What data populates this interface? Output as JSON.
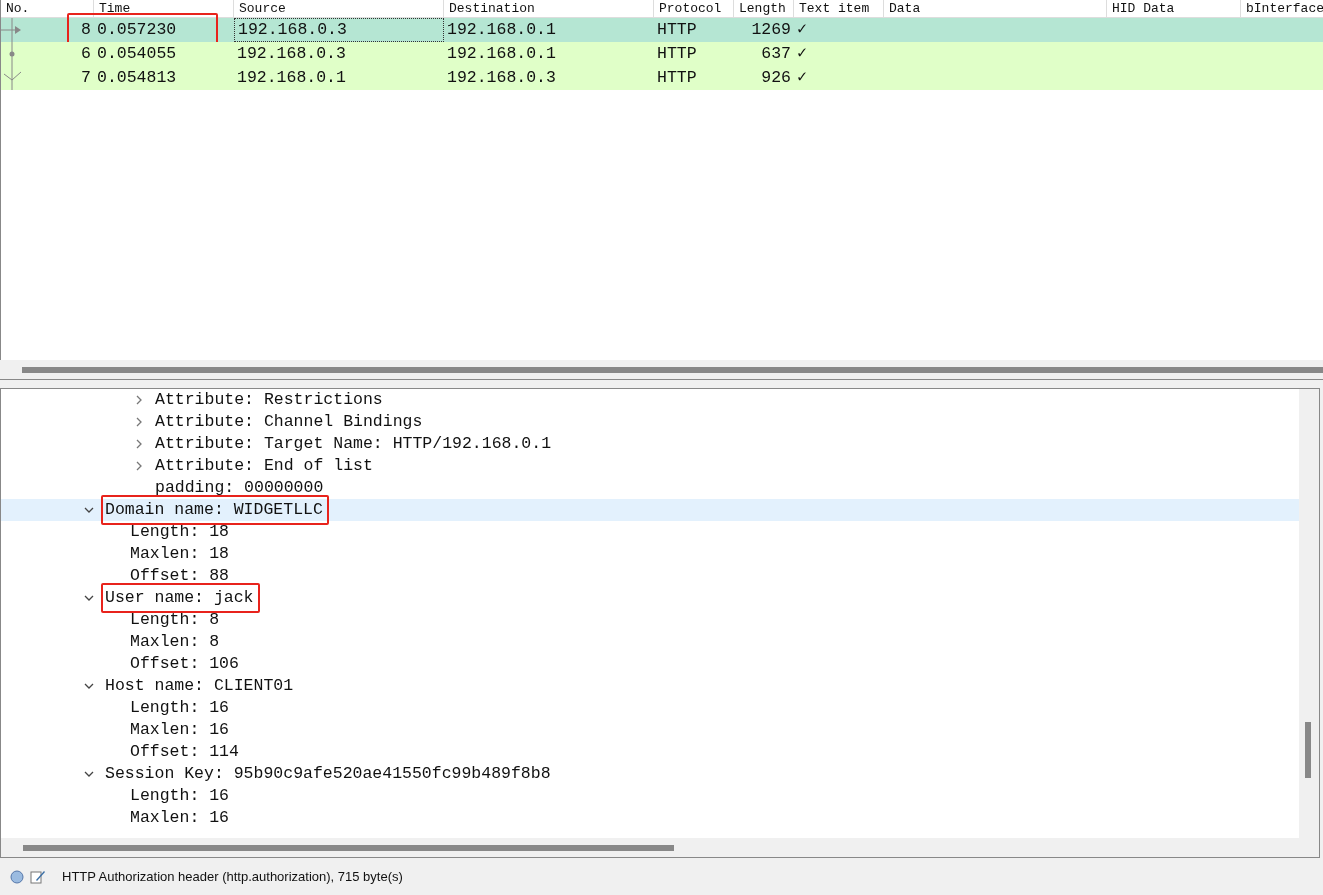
{
  "packet_list": {
    "columns": [
      "No.",
      "Time",
      "Source",
      "Destination",
      "Protocol",
      "Length",
      "Text item",
      "Data",
      "HID Data",
      "bInterface"
    ],
    "rows": [
      {
        "selected": true,
        "annotated": true,
        "kind": "arrow",
        "cells": [
          "8",
          "0.057230",
          "192.168.0.3",
          "192.168.0.1",
          "HTTP",
          "1269",
          "✓"
        ]
      },
      {
        "selected": false,
        "annotated": false,
        "kind": "dot",
        "cells": [
          "6",
          "0.054055",
          "192.168.0.3",
          "192.168.0.1",
          "HTTP",
          "637",
          "✓"
        ]
      },
      {
        "selected": false,
        "annotated": false,
        "kind": "tick",
        "cells": [
          "7",
          "0.054813",
          "192.168.0.1",
          "192.168.0.3",
          "HTTP",
          "926",
          "✓"
        ]
      }
    ]
  },
  "details": [
    {
      "children": [
        {
          "children": [
            {
              "label": "Attribute: Restrictions",
              "expanded": false,
              "selected": false,
              "annotated": false
            },
            {
              "label": "Attribute: Channel Bindings",
              "expanded": false,
              "selected": false,
              "annotated": false
            },
            {
              "label": "Attribute: Target Name: HTTP/192.168.0.1",
              "expanded": false,
              "selected": false,
              "annotated": false
            },
            {
              "label": "Attribute: End of list",
              "expanded": false,
              "selected": false,
              "annotated": false
            },
            {
              "label": "padding: 00000000",
              "selected": false,
              "annotated": false
            }
          ]
        }
      ]
    },
    {
      "label": "Domain name: WIDGETLLC",
      "expanded": true,
      "selected": true,
      "annotated": true,
      "children": [
        {
          "label": "Length: 18",
          "selected": false,
          "annotated": false
        },
        {
          "label": "Maxlen: 18",
          "selected": false,
          "annotated": false
        },
        {
          "label": "Offset: 88",
          "selected": false,
          "annotated": false
        }
      ]
    },
    {
      "label": "User name: jack",
      "expanded": true,
      "selected": false,
      "annotated": true,
      "children": [
        {
          "label": "Length: 8",
          "selected": false,
          "annotated": false
        },
        {
          "label": "Maxlen: 8",
          "selected": false,
          "annotated": false
        },
        {
          "label": "Offset: 106",
          "selected": false,
          "annotated": false
        }
      ]
    },
    {
      "label": "Host name: CLIENT01",
      "expanded": true,
      "selected": false,
      "annotated": false,
      "children": [
        {
          "label": "Length: 16",
          "selected": false,
          "annotated": false
        },
        {
          "label": "Maxlen: 16",
          "selected": false,
          "annotated": false
        },
        {
          "label": "Offset: 114",
          "selected": false,
          "annotated": false
        }
      ]
    },
    {
      "label": "Session Key: 95b90c9afe520ae41550fc99b489f8b8",
      "expanded": true,
      "selected": false,
      "annotated": false,
      "children": [
        {
          "label": "Length: 16",
          "selected": false,
          "annotated": false
        },
        {
          "label": "Maxlen: 16",
          "selected": false,
          "annotated": false
        }
      ]
    }
  ],
  "status_bar": {
    "text": "HTTP Authorization header (http.authorization), 715 byte(s)"
  }
}
